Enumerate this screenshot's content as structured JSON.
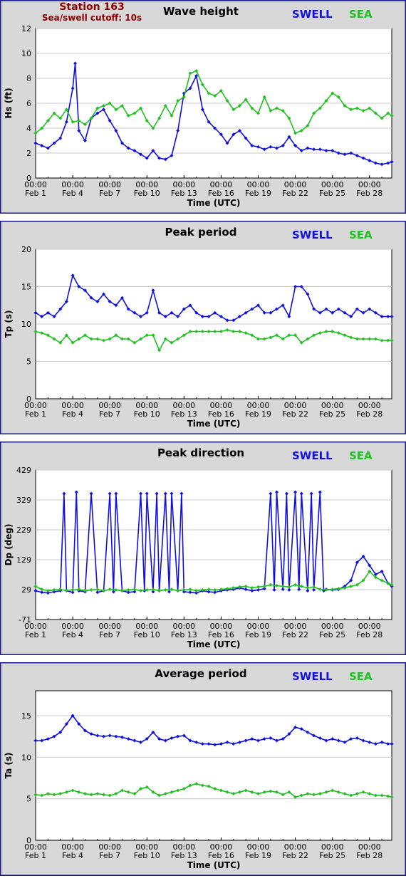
{
  "header": {
    "station": "Station 163",
    "cutoff": "Sea/swell cutoff: 10s"
  },
  "colors": {
    "swell": "#1010e0",
    "sea": "#20c020"
  },
  "legend": {
    "swell": "SWELL",
    "sea": "SEA"
  },
  "x_axis": {
    "label": "Time (UTC)",
    "tick_days": [
      1,
      4,
      7,
      10,
      13,
      16,
      19,
      22,
      25,
      28
    ],
    "tick_top": [
      "00:00",
      "00:00",
      "00:00",
      "00:00",
      "00:00",
      "00:00",
      "00:00",
      "00:00",
      "00:00",
      "00:00"
    ],
    "tick_bottom": [
      "Feb 1",
      "Feb 4",
      "Feb 7",
      "Feb 10",
      "Feb 13",
      "Feb 16",
      "Feb 19",
      "Feb 22",
      "Feb 25",
      "Feb 28"
    ],
    "range_days": [
      1,
      29.8
    ]
  },
  "chart_data": [
    {
      "type": "line",
      "title": "Wave height",
      "ylabel": "Hs (ft)",
      "ylim": [
        0,
        12
      ],
      "yticks": [
        "0",
        "2",
        "4",
        "6",
        "8",
        "10",
        "12"
      ],
      "grid": true,
      "legend_position": "top-right",
      "series": [
        {
          "name": "SWELL",
          "x": [
            1,
            1.5,
            2,
            2.5,
            3,
            3.5,
            4,
            4.2,
            4.5,
            5,
            5.5,
            6,
            6.5,
            7,
            7.5,
            8,
            8.5,
            9,
            9.5,
            10,
            10.5,
            11,
            11.5,
            12,
            12.5,
            13,
            13.5,
            14,
            14.5,
            15,
            15.5,
            16,
            16.5,
            17,
            17.5,
            18,
            18.5,
            19,
            19.5,
            20,
            20.5,
            21,
            21.5,
            22,
            22.5,
            23,
            23.5,
            24,
            24.5,
            25,
            25.5,
            26,
            26.5,
            27,
            27.5,
            28,
            28.5,
            29,
            29.5,
            29.8
          ],
          "y": [
            2.8,
            2.6,
            2.4,
            2.8,
            3.2,
            4.5,
            7.2,
            9.2,
            3.8,
            3.0,
            4.8,
            5.2,
            5.5,
            4.6,
            3.8,
            2.8,
            2.4,
            2.2,
            1.9,
            1.6,
            2.2,
            1.6,
            1.5,
            1.8,
            3.8,
            6.8,
            7.2,
            8.2,
            5.5,
            4.5,
            4.0,
            3.5,
            2.8,
            3.5,
            3.8,
            3.2,
            2.6,
            2.5,
            2.3,
            2.5,
            2.4,
            2.6,
            3.3,
            2.6,
            2.2,
            2.4,
            2.3,
            2.3,
            2.2,
            2.2,
            2.0,
            1.9,
            2.0,
            1.8,
            1.6,
            1.4,
            1.2,
            1.1,
            1.2,
            1.3
          ]
        },
        {
          "name": "SEA",
          "x": [
            1,
            1.5,
            2,
            2.5,
            3,
            3.5,
            4,
            4.5,
            5,
            5.5,
            6,
            6.5,
            7,
            7.5,
            8,
            8.5,
            9,
            9.5,
            10,
            10.5,
            11,
            11.5,
            12,
            12.5,
            13,
            13.5,
            14,
            14.5,
            15,
            15.5,
            16,
            16.5,
            17,
            17.5,
            18,
            18.5,
            19,
            19.5,
            20,
            20.5,
            21,
            21.5,
            22,
            22.5,
            23,
            23.5,
            24,
            24.5,
            25,
            25.5,
            26,
            26.5,
            27,
            27.5,
            28,
            28.5,
            29,
            29.5,
            29.8
          ],
          "y": [
            3.6,
            4.0,
            4.6,
            5.2,
            4.8,
            5.5,
            4.5,
            4.6,
            4.3,
            4.8,
            5.6,
            5.8,
            6.0,
            5.5,
            5.8,
            5.0,
            5.2,
            5.6,
            4.6,
            4.0,
            4.8,
            5.8,
            5.0,
            6.2,
            6.5,
            8.4,
            8.6,
            7.5,
            6.8,
            6.6,
            7.0,
            6.2,
            5.5,
            5.8,
            6.3,
            5.6,
            5.2,
            6.5,
            5.4,
            5.6,
            5.4,
            4.8,
            3.6,
            3.8,
            4.2,
            5.2,
            5.6,
            6.2,
            6.8,
            6.5,
            5.8,
            5.5,
            5.6,
            5.4,
            5.6,
            5.2,
            4.8,
            5.2,
            5.0
          ]
        }
      ]
    },
    {
      "type": "line",
      "title": "Peak period",
      "ylabel": "Tp (s)",
      "ylim": [
        0,
        20
      ],
      "yticks": [
        "0",
        "5",
        "10",
        "15",
        "20"
      ],
      "grid": true,
      "legend_position": "top-right",
      "series": [
        {
          "name": "SWELL",
          "x": [
            1,
            1.5,
            2,
            2.5,
            3,
            3.5,
            4,
            4.5,
            5,
            5.5,
            6,
            6.5,
            7,
            7.5,
            8,
            8.5,
            9,
            9.5,
            10,
            10.5,
            11,
            11.5,
            12,
            12.5,
            13,
            13.5,
            14,
            14.5,
            15,
            15.5,
            16,
            16.5,
            17,
            17.5,
            18,
            18.5,
            19,
            19.5,
            20,
            20.5,
            21,
            21.5,
            22,
            22.5,
            23,
            23.5,
            24,
            24.5,
            25,
            25.5,
            26,
            26.5,
            27,
            27.5,
            28,
            28.5,
            29,
            29.5,
            29.8
          ],
          "y": [
            11.5,
            11.0,
            11.5,
            11.0,
            12.0,
            13.0,
            16.5,
            15.0,
            14.5,
            13.5,
            13.0,
            14.0,
            13.0,
            12.5,
            13.5,
            12.0,
            11.5,
            11.0,
            11.5,
            14.5,
            11.5,
            11.0,
            11.5,
            11.0,
            12.0,
            12.5,
            11.5,
            11.0,
            11.0,
            11.5,
            11.0,
            10.5,
            10.5,
            11.0,
            11.5,
            12.0,
            12.5,
            11.5,
            11.5,
            12.0,
            12.5,
            11.0,
            15.0,
            15.0,
            14.0,
            12.0,
            11.5,
            12.0,
            11.5,
            12.0,
            11.5,
            11.0,
            12.0,
            11.5,
            12.0,
            11.5,
            11.0,
            11.0,
            11.0
          ]
        },
        {
          "name": "SEA",
          "x": [
            1,
            1.5,
            2,
            2.5,
            3,
            3.5,
            4,
            4.5,
            5,
            5.5,
            6,
            6.5,
            7,
            7.5,
            8,
            8.5,
            9,
            9.5,
            10,
            10.5,
            11,
            11.5,
            12,
            12.5,
            13,
            13.5,
            14,
            14.5,
            15,
            15.5,
            16,
            16.5,
            17,
            17.5,
            18,
            18.5,
            19,
            19.5,
            20,
            20.5,
            21,
            21.5,
            22,
            22.5,
            23,
            23.5,
            24,
            24.5,
            25,
            25.5,
            26,
            26.5,
            27,
            27.5,
            28,
            28.5,
            29,
            29.5,
            29.8
          ],
          "y": [
            9.0,
            8.8,
            8.5,
            8.0,
            7.5,
            8.5,
            7.5,
            8.0,
            8.5,
            8.0,
            8.0,
            7.8,
            8.0,
            8.5,
            8.0,
            8.0,
            7.5,
            8.0,
            8.5,
            8.5,
            6.5,
            8.0,
            7.5,
            8.0,
            8.5,
            9.0,
            9.0,
            9.0,
            9.0,
            9.0,
            9.0,
            9.2,
            9.0,
            9.0,
            8.8,
            8.5,
            8.0,
            8.0,
            8.2,
            8.5,
            8.0,
            8.5,
            8.5,
            7.5,
            8.0,
            8.5,
            8.8,
            9.0,
            9.0,
            8.8,
            8.5,
            8.2,
            8.0,
            8.0,
            8.0,
            8.0,
            7.8,
            7.8,
            7.8
          ]
        }
      ]
    },
    {
      "type": "line",
      "title": "Peak direction",
      "ylabel": "Dp (deg)",
      "ylim": [
        -71,
        429
      ],
      "yticks": [
        "-71",
        "29",
        "129",
        "229",
        "329",
        "429"
      ],
      "grid": true,
      "legend_position": "top-right",
      "series": [
        {
          "name": "SWELL",
          "x": [
            1,
            1.5,
            2,
            2.5,
            3,
            3.3,
            3.5,
            4,
            4.3,
            4.5,
            5,
            5.5,
            6,
            6.5,
            7,
            7.3,
            7.5,
            8,
            8.5,
            9,
            9.5,
            9.8,
            10,
            10.5,
            10.8,
            11,
            11.5,
            11.8,
            12,
            12.5,
            12.8,
            13,
            13.5,
            14,
            14.5,
            15,
            15.5,
            16,
            16.5,
            17,
            17.5,
            18,
            18.5,
            19,
            19.5,
            20,
            20.3,
            20.5,
            21,
            21.3,
            21.5,
            22,
            22.3,
            22.5,
            23,
            23.3,
            23.5,
            24,
            24.3,
            24.5,
            25,
            25.5,
            26,
            26.5,
            27,
            27.5,
            28,
            28.5,
            29,
            29.5,
            29.8
          ],
          "y": [
            25,
            20,
            18,
            22,
            25,
            350,
            25,
            20,
            355,
            25,
            22,
            350,
            20,
            25,
            350,
            22,
            350,
            25,
            20,
            22,
            350,
            25,
            350,
            22,
            350,
            25,
            350,
            22,
            350,
            25,
            350,
            22,
            20,
            18,
            25,
            22,
            20,
            25,
            28,
            30,
            35,
            30,
            25,
            28,
            32,
            350,
            28,
            355,
            30,
            350,
            28,
            355,
            30,
            350,
            25,
            350,
            28,
            355,
            25,
            30,
            28,
            30,
            40,
            60,
            120,
            140,
            110,
            80,
            90,
            50,
            40
          ]
        },
        {
          "name": "SEA",
          "x": [
            1,
            1.5,
            2,
            2.5,
            3,
            3.5,
            4,
            4.5,
            5,
            5.5,
            6,
            6.5,
            7,
            7.5,
            8,
            8.5,
            9,
            9.5,
            10,
            10.5,
            11,
            11.5,
            12,
            12.5,
            13,
            13.5,
            14,
            14.5,
            15,
            15.5,
            16,
            16.5,
            17,
            17.5,
            18,
            18.5,
            19,
            19.5,
            20,
            20.5,
            21,
            21.5,
            22,
            22.5,
            23,
            23.5,
            24,
            24.5,
            25,
            25.5,
            26,
            26.5,
            27,
            27.5,
            28,
            28.5,
            29,
            29.5,
            29.8
          ],
          "y": [
            40,
            30,
            25,
            28,
            30,
            25,
            28,
            30,
            25,
            28,
            30,
            25,
            30,
            28,
            25,
            28,
            30,
            25,
            28,
            30,
            25,
            28,
            30,
            25,
            28,
            30,
            25,
            28,
            30,
            28,
            30,
            32,
            35,
            38,
            40,
            35,
            38,
            40,
            45,
            42,
            40,
            38,
            45,
            40,
            35,
            38,
            30,
            28,
            30,
            32,
            35,
            40,
            45,
            60,
            90,
            70,
            60,
            50,
            45
          ]
        }
      ]
    },
    {
      "type": "line",
      "title": "Average period",
      "ylabel": "Ta (s)",
      "ylim": [
        0,
        18
      ],
      "yticks": [
        "0",
        "5",
        "10",
        "15"
      ],
      "grid": true,
      "legend_position": "top-right",
      "series": [
        {
          "name": "SWELL",
          "x": [
            1,
            1.5,
            2,
            2.5,
            3,
            3.5,
            4,
            4.5,
            5,
            5.5,
            6,
            6.5,
            7,
            7.5,
            8,
            8.5,
            9,
            9.5,
            10,
            10.5,
            11,
            11.5,
            12,
            12.5,
            13,
            13.5,
            14,
            14.5,
            15,
            15.5,
            16,
            16.5,
            17,
            17.5,
            18,
            18.5,
            19,
            19.5,
            20,
            20.5,
            21,
            21.5,
            22,
            22.5,
            23,
            23.5,
            24,
            24.5,
            25,
            25.5,
            26,
            26.5,
            27,
            27.5,
            28,
            28.5,
            29,
            29.5,
            29.8
          ],
          "y": [
            12.0,
            12.0,
            12.2,
            12.5,
            13.0,
            14.0,
            15.0,
            14.0,
            13.2,
            12.8,
            12.6,
            12.5,
            12.6,
            12.5,
            12.4,
            12.2,
            12.0,
            11.8,
            12.2,
            13.0,
            12.2,
            12.0,
            12.3,
            12.5,
            12.6,
            12.0,
            11.8,
            11.6,
            11.6,
            11.5,
            11.6,
            11.8,
            11.6,
            11.8,
            12.0,
            12.2,
            12.0,
            12.2,
            12.3,
            12.0,
            12.2,
            12.8,
            13.6,
            13.4,
            13.0,
            12.6,
            12.3,
            12.0,
            12.2,
            12.0,
            11.8,
            12.2,
            12.3,
            12.0,
            11.8,
            11.6,
            11.8,
            11.6,
            11.6
          ]
        },
        {
          "name": "SEA",
          "x": [
            1,
            1.5,
            2,
            2.5,
            3,
            3.5,
            4,
            4.5,
            5,
            5.5,
            6,
            6.5,
            7,
            7.5,
            8,
            8.5,
            9,
            9.5,
            10,
            10.5,
            11,
            11.5,
            12,
            12.5,
            13,
            13.5,
            14,
            14.5,
            15,
            15.5,
            16,
            16.5,
            17,
            17.5,
            18,
            18.5,
            19,
            19.5,
            20,
            20.5,
            21,
            21.5,
            22,
            22.5,
            23,
            23.5,
            24,
            24.5,
            25,
            25.5,
            26,
            26.5,
            27,
            27.5,
            28,
            28.5,
            29,
            29.5,
            29.8
          ],
          "y": [
            5.5,
            5.4,
            5.6,
            5.5,
            5.6,
            5.8,
            6.0,
            5.8,
            5.6,
            5.5,
            5.6,
            5.5,
            5.4,
            5.6,
            6.0,
            5.8,
            5.6,
            6.2,
            6.4,
            5.8,
            5.4,
            5.6,
            5.8,
            6.0,
            6.2,
            6.6,
            6.8,
            6.6,
            6.5,
            6.2,
            6.0,
            5.8,
            5.6,
            5.8,
            6.0,
            5.8,
            5.6,
            5.8,
            5.9,
            5.8,
            5.5,
            5.8,
            5.2,
            5.4,
            5.6,
            5.5,
            5.6,
            5.8,
            6.0,
            5.8,
            5.6,
            5.4,
            5.6,
            5.8,
            5.6,
            5.4,
            5.4,
            5.3,
            5.2
          ]
        }
      ]
    }
  ]
}
